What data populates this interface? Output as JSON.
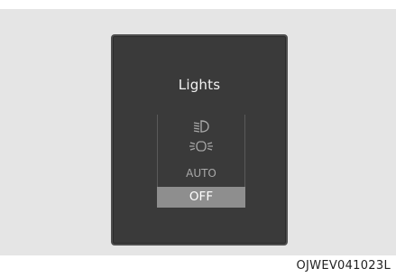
{
  "panel": {
    "title": "Lights",
    "items": [
      {
        "icon": "low-beam-headlamp-icon"
      },
      {
        "icon": "position-lamp-icon"
      },
      {
        "label": "AUTO"
      },
      {
        "label": "OFF",
        "selected": true
      }
    ]
  },
  "caption": "OJWEV041023L",
  "colors": {
    "panel_background": "#3a3a3a",
    "selection_highlight": "#8e8e8e",
    "inactive_text": "#a8a8a8"
  }
}
